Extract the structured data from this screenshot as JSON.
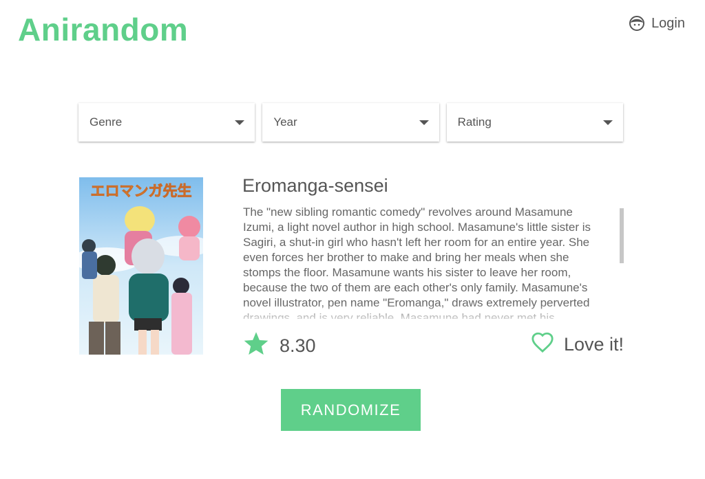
{
  "header": {
    "logo": "Anirandom",
    "login_label": "Login",
    "login_icon": "user-face-icon"
  },
  "filters": [
    {
      "label": "Genre",
      "icon": "caret-down-icon"
    },
    {
      "label": "Year",
      "icon": "caret-down-icon"
    },
    {
      "label": "Rating",
      "icon": "caret-down-icon"
    }
  ],
  "anime": {
    "title": "Eromanga-sensei",
    "poster_title": "エロマンガ先生",
    "synopsis": "The \"new sibling romantic comedy\" revolves around Masamune Izumi, a light novel author in high school. Masamune's little sister is Sagiri, a shut-in girl who hasn't left her room for an entire year. She even forces her brother to make and bring her meals when she stomps the floor. Masamune wants his sister to leave her room, because the two of them are each other's only family. Masamune's novel illustrator, pen name \"Eromanga,\" draws extremely perverted drawings, and is very reliable. Masamune had never met his",
    "score": "8.30",
    "score_icon": "star-icon",
    "love_label": "Love it!",
    "love_icon": "heart-outline-icon"
  },
  "actions": {
    "randomize_label": "RANDOMIZE"
  },
  "colors": {
    "brand": "#5fcf8a",
    "text": "#555555"
  }
}
